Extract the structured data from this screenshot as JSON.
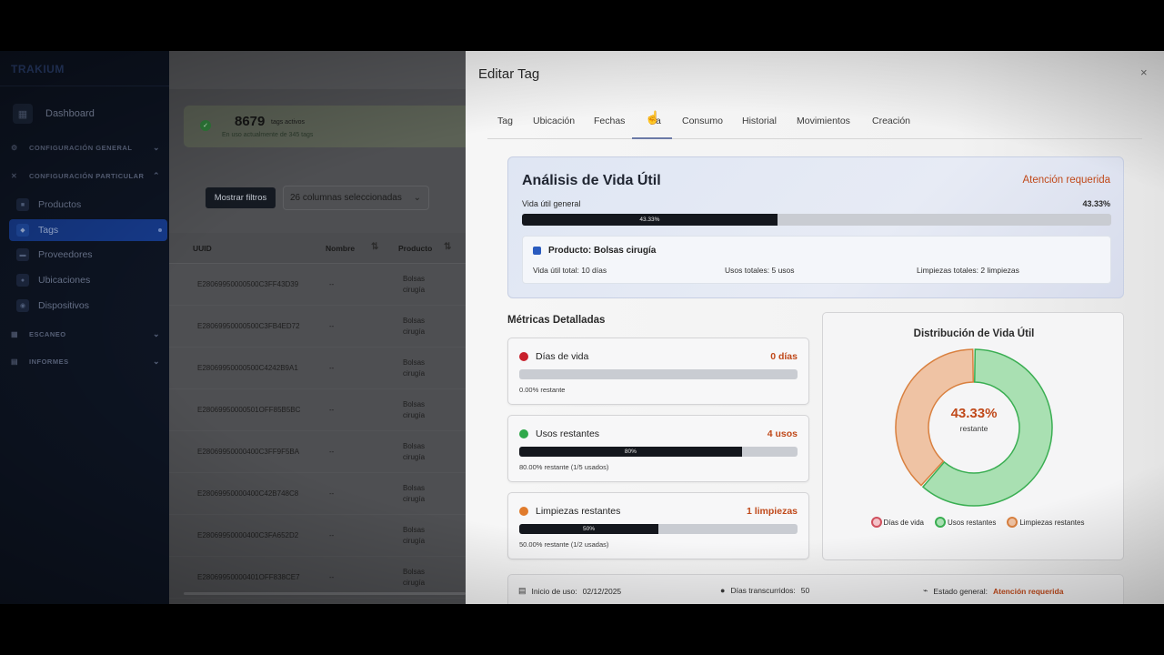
{
  "sidebar": {
    "brand": "TRAKIUM",
    "dashboard": "Dashboard",
    "sections": [
      {
        "label": "CONFIGURACIÓN GENERAL"
      },
      {
        "label": "CONFIGURACIÓN PARTICULAR"
      },
      {
        "label": "ESCANEO"
      },
      {
        "label": "INFORMES"
      }
    ],
    "items": [
      {
        "label": "Productos"
      },
      {
        "label": "Tags"
      },
      {
        "label": "Proveedores"
      },
      {
        "label": "Ubicaciones"
      },
      {
        "label": "Dispositivos"
      }
    ]
  },
  "background": {
    "stat_number": "8679",
    "stat_label": "tags activos",
    "stat_sub": "En uso actualmente de 345 tags",
    "filter_button": "Mostrar filtros",
    "columns_select": "26 columnas seleccionadas",
    "table_headers": {
      "uuid": "UUID",
      "nombre": "Nombre",
      "producto": "Producto"
    },
    "rows": [
      {
        "uuid": "E28069950000500C3FF43D39",
        "nombre": "--",
        "producto": "Bolsas cirugía"
      },
      {
        "uuid": "E28069950000500C3FB4ED72",
        "nombre": "--",
        "producto": "Bolsas cirugía"
      },
      {
        "uuid": "E28069950000500C4242B9A1",
        "nombre": "--",
        "producto": "Bolsas cirugía"
      },
      {
        "uuid": "E28069950000501OFF85B5BC",
        "nombre": "--",
        "producto": "Bolsas cirugía"
      },
      {
        "uuid": "E28069950000400C3FF9F5BA",
        "nombre": "--",
        "producto": "Bolsas cirugía"
      },
      {
        "uuid": "E28069950000400C42B748C8",
        "nombre": "--",
        "producto": "Bolsas cirugía"
      },
      {
        "uuid": "E28069950000400C3FA652D2",
        "nombre": "--",
        "producto": "Bolsas cirugía"
      },
      {
        "uuid": "E28069950000401OFF838CE7",
        "nombre": "--",
        "producto": "Bolsas cirugía"
      }
    ]
  },
  "modal": {
    "title": "Editar Tag",
    "close": "×",
    "tabs": [
      "Tag",
      "Ubicación",
      "Fechas",
      "a",
      "Consumo",
      "Historial",
      "Movimientos",
      "Creación"
    ],
    "active_tab_index": 3,
    "analysis": {
      "title": "Análisis de Vida Útil",
      "status": "Atención requerida",
      "label": "Vida útil general",
      "percent_text": "43.33%",
      "percent": 43.33,
      "product": "Producto: Bolsas cirugía",
      "total_life": "Vida útil total: 10 días",
      "total_uses": "Usos totales: 5 usos",
      "total_cleanings": "Limpiezas totales: 2 limpiezas"
    },
    "metrics_title": "Métricas Detalladas",
    "metrics": [
      {
        "name": "Días de vida",
        "value": "0 días",
        "percent": 0,
        "bar_label": "",
        "note": "0.00% restante",
        "color": "#c8202c"
      },
      {
        "name": "Usos restantes",
        "value": "4 usos",
        "percent": 80,
        "bar_label": "80%",
        "note": "80.00% restante (1/5 usados)",
        "color": "#2fa84a"
      },
      {
        "name": "Limpiezas restantes",
        "value": "1 limpiezas",
        "percent": 50,
        "bar_label": "50%",
        "note": "50.00% restante (1/2 usadas)",
        "color": "#e07b2c"
      }
    ],
    "donut": {
      "title": "Distribución de Vida Útil",
      "center_value": "43.33%",
      "center_label": "restante",
      "legend": [
        {
          "label": "Días de vida",
          "fill": "#f3c2c8",
          "stroke": "#d0505e"
        },
        {
          "label": "Usos restantes",
          "fill": "#a9e0b2",
          "stroke": "#3aae52"
        },
        {
          "label": "Limpiezas restantes",
          "fill": "#efc3a4",
          "stroke": "#d9803f"
        }
      ],
      "segments": [
        {
          "name": "Días de vida",
          "value": 0,
          "fill": "#f3c2c8",
          "stroke": "#d0505e"
        },
        {
          "name": "Usos restantes",
          "value": 80,
          "fill": "#a9e0b2",
          "stroke": "#3aae52"
        },
        {
          "name": "Limpiezas restantes",
          "value": 50,
          "fill": "#efc3a4",
          "stroke": "#d9803f"
        }
      ]
    },
    "footer": {
      "start_label": "Inicio de uso:",
      "start_value": "02/12/2025",
      "days_label": "Días transcurridos:",
      "days_value": "50",
      "status_label": "Estado general:",
      "status_value": "Atención requerida"
    }
  }
}
